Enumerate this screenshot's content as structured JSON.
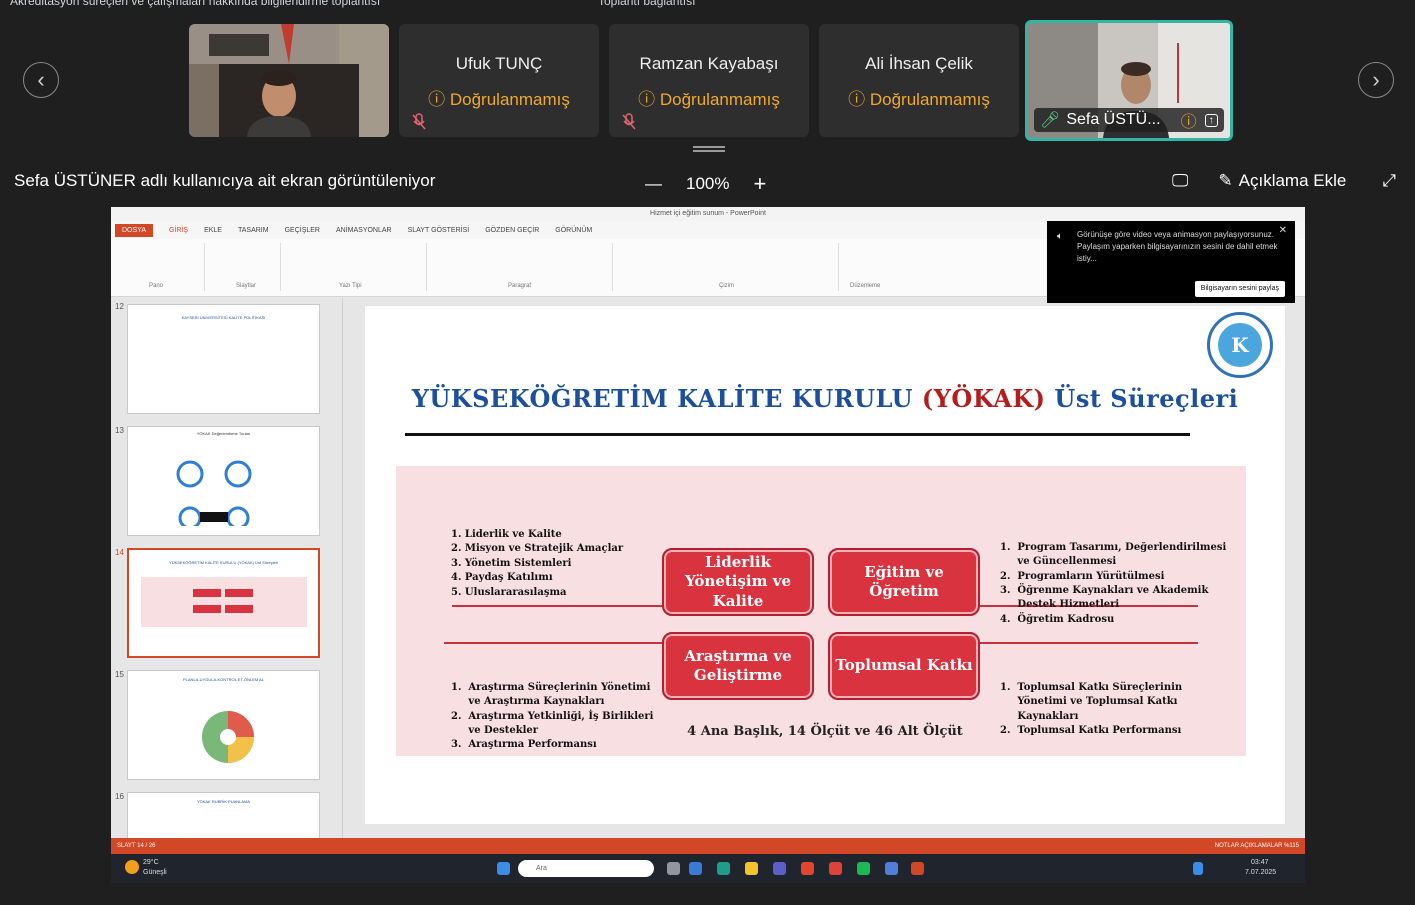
{
  "header": {
    "top_left_text": "Akreditasyon süreçleri ve çalışmaları hakkında bilgilendirme toplantısı",
    "top_right_text": "Toplantı bağlantısı"
  },
  "participants": [
    {
      "name": "",
      "status": "",
      "type": "camera"
    },
    {
      "name": "Ufuk TUNÇ",
      "status": "Doğrulanmamış",
      "muted": true
    },
    {
      "name": "Ramzan Kayabaşı",
      "status": "Doğrulanmamış",
      "muted": true
    },
    {
      "name": "Ali İhsan Çelik",
      "status": "Doğrulanmamış",
      "muted": false
    },
    {
      "name": "Sefa ÜSTÜ...",
      "status": "",
      "type": "camera",
      "active": true
    }
  ],
  "share": {
    "title": "Sefa ÜSTÜNER adlı kullanıcıya ait ekran görüntüleniyor",
    "zoom": "100%",
    "annotate_label": "Açıklama Ekle"
  },
  "ppt": {
    "window_title": "Hizmet içi eğitim sunum - PowerPoint",
    "tabs": [
      "DOSYA",
      "GİRİŞ",
      "EKLE",
      "TASARIM",
      "GEÇİŞLER",
      "ANİMASYONLAR",
      "SLAYT GÖSTERİSİ",
      "GÖZDEN GEÇİR",
      "GÖRÜNÜM"
    ],
    "groups": [
      "Pano",
      "Slaytlar",
      "Yazı Tipi",
      "Paragraf",
      "Çizim",
      "Düzenleme"
    ],
    "thumb_numbers": [
      "12",
      "13",
      "14",
      "15",
      "16"
    ],
    "thumb_titles": [
      "KAYSERİ ÜNİVERSİTESİ KALİTE POLİTİKASI",
      "YÖKAK Değerlendirme Turları",
      "YÜKSEKÖĞRETİM KALİTE KURULU (YÖKAK) Üst Süreçleri",
      "PLANLA-UYGULA-KONTROL ET-ÖNLEM AL",
      "YÖKAK RUBRİK PUANLAMA"
    ],
    "status_left": "SLAYT 14 / 26",
    "status_right": "NOTLAR   AÇIKLAMALAR   %115"
  },
  "toast": {
    "text": "Görünüşe göre video veya animasyon paylaşıyorsunuz. Paylaşım yaparken bilgisayarınızın sesini de dahil etmek istiy...",
    "button": "Bilgisayarın sesini paylaş"
  },
  "slide": {
    "title_a": "YÜKSEKÖĞRETİM KALİTE KURULU ",
    "title_b": "(YÖKAK)",
    "title_c": " Üst Süreçleri",
    "boxes": [
      "Liderlik Yönetişim ve Kalite",
      "Eğitim ve Öğretim",
      "Araştırma ve Geliştirme",
      "Toplumsal Katkı"
    ],
    "list_tl": [
      "1.  Liderlik ve Kalite",
      "2.  Misyon ve Stratejik Amaçlar",
      "3.  Yönetim Sistemleri",
      "4.  Paydaş Katılımı",
      "5.  Uluslararasılaşma"
    ],
    "list_tr": [
      "1.  Program Tasarımı, Değerlendirilmesi",
      "     ve Güncellenmesi",
      "2.  Programların Yürütülmesi",
      "3.  Öğrenme Kaynakları ve Akademik",
      "     Destek Hizmetleri",
      "4.  Öğretim Kadrosu"
    ],
    "list_bl": [
      "1.  Araştırma Süreçlerinin Yönetimi",
      "     ve Araştırma Kaynakları",
      "2.  Araştırma Yetkinliği, İş Birlikleri",
      "     ve Destekler",
      "3.  Araştırma Performansı"
    ],
    "list_br": [
      "1.  Toplumsal Katkı Süreçlerinin",
      "     Yönetimi ve Toplumsal Katkı",
      "     Kaynakları",
      "2.  Toplumsal Katkı Performansı"
    ],
    "summary": "4 Ana Başlık, 14 Ölçüt ve 46 Alt Ölçüt"
  },
  "taskbar": {
    "weather_temp": "29°C",
    "weather_desc": "Güneşli",
    "search_placeholder": "Ara",
    "time": "03:47",
    "date": "7.07.2025"
  }
}
